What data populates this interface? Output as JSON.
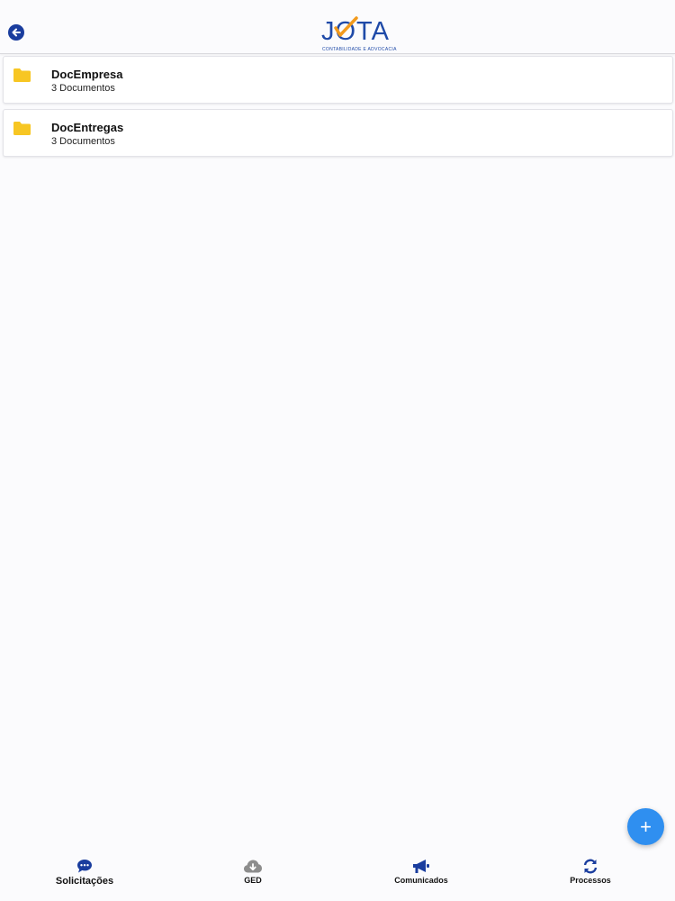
{
  "header": {
    "back_icon": "arrow-left-circle-icon",
    "logo": {
      "text": "JOTA",
      "subtitle": "CONTABILIDADE E ADVOCACIA"
    }
  },
  "folders": [
    {
      "name": "DocEmpresa",
      "count": "3 Documentos",
      "icon": "folder-icon"
    },
    {
      "name": "DocEntregas",
      "count": "3 Documentos",
      "icon": "folder-icon"
    }
  ],
  "fab": {
    "label": "+"
  },
  "tabs": [
    {
      "label": "Solicitações",
      "icon": "chat-bubble-icon"
    },
    {
      "label": "GED",
      "icon": "cloud-download-icon"
    },
    {
      "label": "Comunicados",
      "icon": "megaphone-icon"
    },
    {
      "label": "Processos",
      "icon": "sync-icon"
    }
  ],
  "colors": {
    "brand_blue": "#1f4aa8",
    "accent_orange": "#f29a1d",
    "folder_yellow": "#f7c623",
    "fab_blue": "#2f8ff0",
    "inactive_gray": "#8d8d8d"
  }
}
